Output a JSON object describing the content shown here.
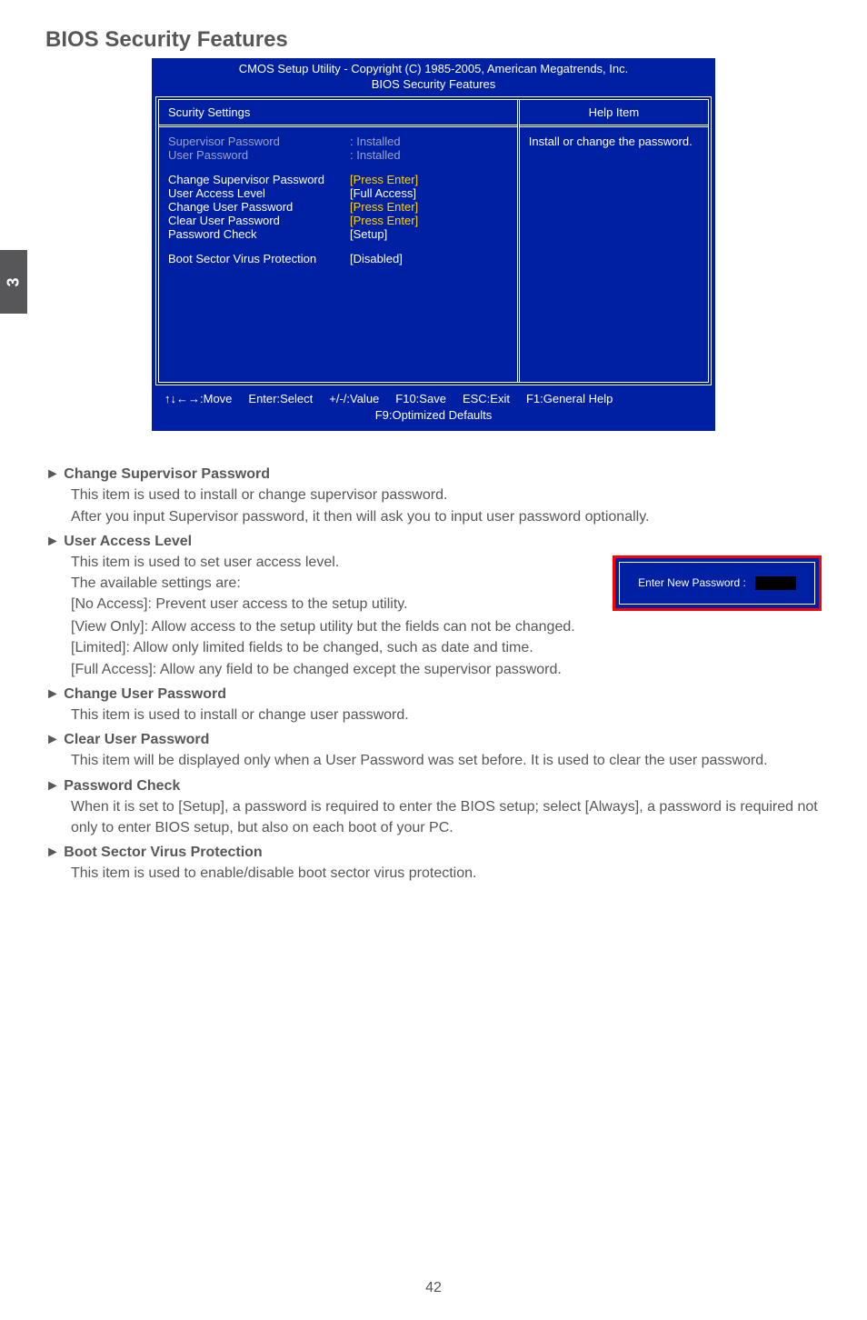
{
  "sideTab": "3",
  "pageTitle": "BIOS Security Features",
  "bios": {
    "headerLine1": "CMOS Setup Utility - Copyright (C) 1985-2005, American Megatrends, Inc.",
    "headerLine2": "BIOS Security Features",
    "leftHeader": "Scurity Settings",
    "rightHeader": "Help Item",
    "helpText": "Install or change the password.",
    "status": {
      "supLabel": "Supervisor Password",
      "supVal": ": Installed",
      "userLabel": "User Password",
      "userVal": ": Installed"
    },
    "items": [
      {
        "label": "Change Supervisor Password",
        "val": "[Press Enter]",
        "valClass": "yellow"
      },
      {
        "label": "User Access Level",
        "val": "[Full Access]",
        "valClass": ""
      },
      {
        "label": "Change User Password",
        "val": "[Press Enter]",
        "valClass": "yellow"
      },
      {
        "label": "Clear User Password",
        "val": "[Press Enter]",
        "valClass": "yellow"
      },
      {
        "label": "Password Check",
        "val": "[Setup]",
        "valClass": ""
      }
    ],
    "boot": {
      "label": "Boot Sector Virus Protection",
      "val": "[Disabled]"
    },
    "footer": {
      "move": "↑↓←→:Move",
      "select": "Enter:Select",
      "value": "+/-/:Value",
      "save": "F10:Save",
      "exit": "ESC:Exit",
      "help": "F1:General Help",
      "defaults": "F9:Optimized Defaults"
    }
  },
  "popup": {
    "label": "Enter New Password :"
  },
  "sections": {
    "s1": {
      "title": "► Change Supervisor Password",
      "p1": "This item is used to install or change supervisor password.",
      "p2": "After you input Supervisor password, it then will ask you to input user password optionally."
    },
    "s2": {
      "title": "► User Access Level",
      "p1": "This item is used to set user access level.",
      "p2": "The available settings are:",
      "p3": "[No Access]: Prevent user access to the setup utility.",
      "p4": "[View Only]: Allow access to the setup utility but the fields can not be changed.",
      "p5": "[Limited]: Allow only limited fields to be changed, such as date and time.",
      "p6": "[Full Access]: Allow any field to be changed except the supervisor password."
    },
    "s3": {
      "title": "► Change User Password",
      "p1": "This item is used to install or change user password."
    },
    "s4": {
      "title": "► Clear User Password",
      "p1": "This item will be displayed only when a User Password was set before. It is used to clear the user password."
    },
    "s5": {
      "title": "► Password Check",
      "p1": "When it is set to [Setup], a password is required to enter the BIOS setup; select [Always], a password is required not only to enter BIOS setup, but also on each boot of your PC."
    },
    "s6": {
      "title": "► Boot Sector Virus Protection",
      "p1": "This item is used to enable/disable boot sector virus protection."
    }
  },
  "pageNumber": "42"
}
